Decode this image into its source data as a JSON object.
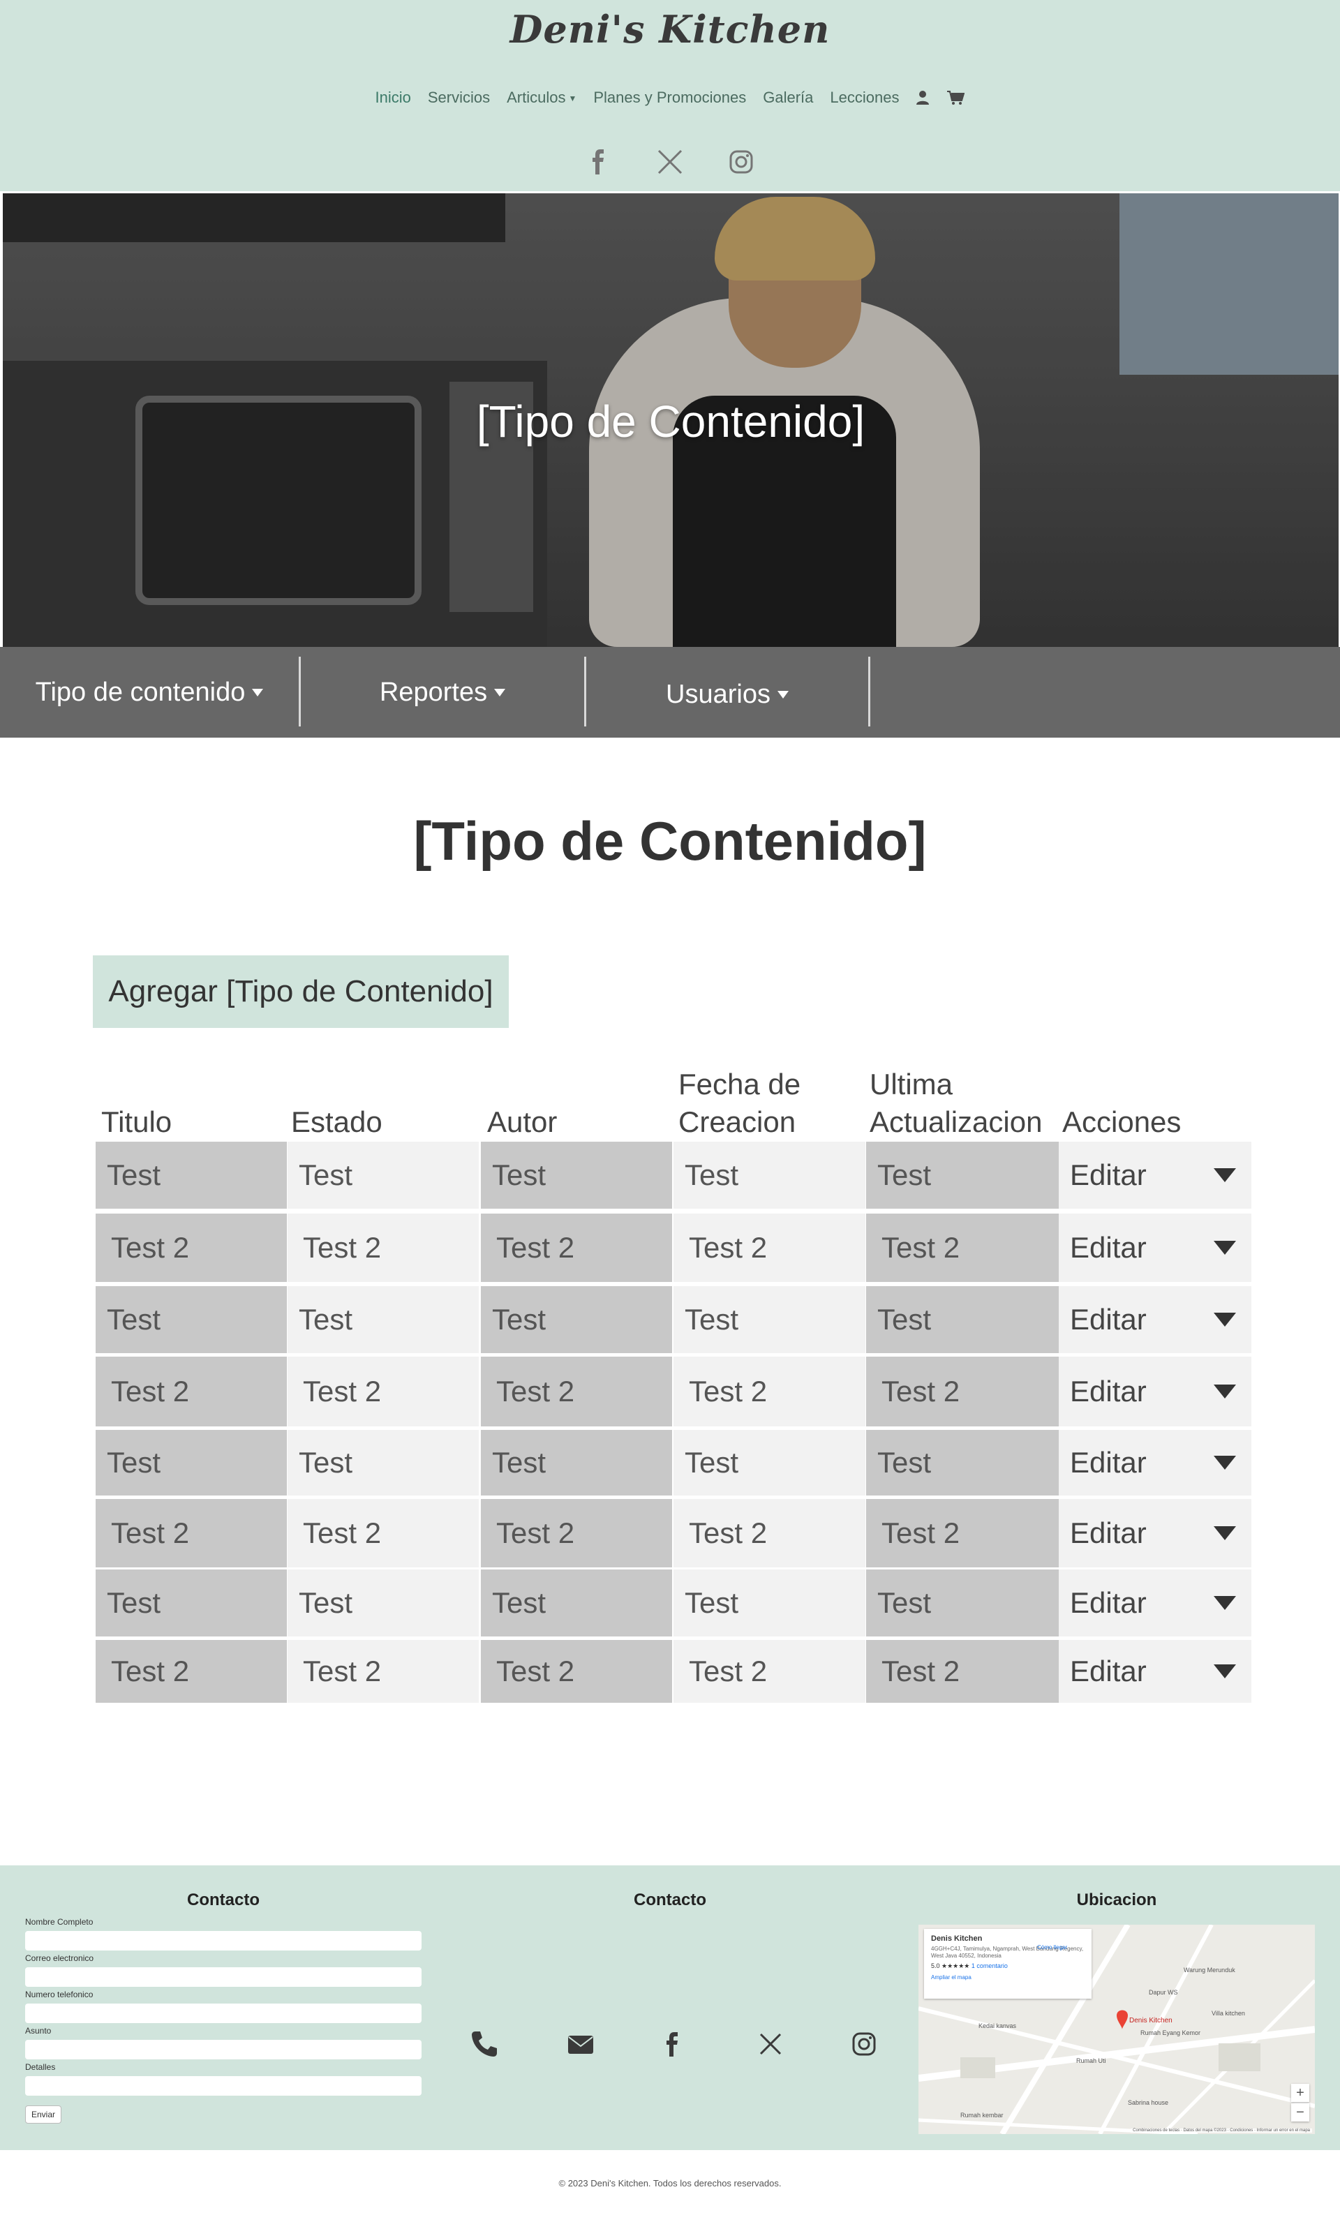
{
  "brand": {
    "name": "Deni's Kitchen"
  },
  "nav": {
    "items": [
      {
        "label": "Inicio"
      },
      {
        "label": "Servicios"
      },
      {
        "label": "Articulos"
      },
      {
        "label": "Planes y Promociones"
      },
      {
        "label": "Galería"
      },
      {
        "label": "Lecciones"
      }
    ],
    "icons": [
      "user-icon",
      "cart-icon"
    ]
  },
  "social_top": [
    "facebook-icon",
    "x-icon",
    "instagram-icon"
  ],
  "hero": {
    "title": "[Tipo de Contenido]"
  },
  "subnav": {
    "items": [
      {
        "label": "Tipo de contenido"
      },
      {
        "label": "Reportes"
      },
      {
        "label": "Usuarios"
      }
    ]
  },
  "main": {
    "title": "[Tipo de Contenido]",
    "add_button": "Agregar [Tipo de Contenido]"
  },
  "table": {
    "headers": [
      "Titulo",
      "Estado",
      "Autor",
      "Fecha de Creacion",
      "Ultima Actualizacion",
      "Acciones"
    ],
    "rows": [
      {
        "cells": [
          "Test",
          "Test",
          "Test",
          "Test",
          "Test"
        ],
        "action": "Editar"
      },
      {
        "cells": [
          "Test 2",
          "Test 2",
          "Test 2",
          "Test 2",
          "Test 2"
        ],
        "action": "Editar"
      },
      {
        "cells": [
          "Test",
          "Test",
          "Test",
          "Test",
          "Test"
        ],
        "action": "Editar"
      },
      {
        "cells": [
          "Test 2",
          "Test 2",
          "Test 2",
          "Test 2",
          "Test 2"
        ],
        "action": "Editar"
      },
      {
        "cells": [
          "Test",
          "Test",
          "Test",
          "Test",
          "Test"
        ],
        "action": "Editar"
      },
      {
        "cells": [
          "Test 2",
          "Test 2",
          "Test 2",
          "Test 2",
          "Test 2"
        ],
        "action": "Editar"
      },
      {
        "cells": [
          "Test",
          "Test",
          "Test",
          "Test",
          "Test"
        ],
        "action": "Editar"
      },
      {
        "cells": [
          "Test 2",
          "Test 2",
          "Test 2",
          "Test 2",
          "Test 2"
        ],
        "action": "Editar"
      }
    ]
  },
  "footer": {
    "contact_form": {
      "heading": "Contacto",
      "fields": [
        {
          "label": "Nombre Completo"
        },
        {
          "label": "Correo electronico"
        },
        {
          "label": "Numero telefonico"
        },
        {
          "label": "Asunto"
        },
        {
          "label": "Detalles"
        }
      ],
      "submit": "Enviar"
    },
    "contact_links": {
      "heading": "Contacto",
      "icons": [
        "phone-icon",
        "email-icon",
        "facebook-icon",
        "x-icon",
        "instagram-icon"
      ]
    },
    "location": {
      "heading": "Ubicacion",
      "map_card": {
        "title": "Denis Kitchen",
        "address": "4GGH+C4J, Tamimulya, Ngamprah, West Bandung Regency, West Java 40552, Indonesia",
        "rating": "5.0 ★★★★★",
        "reviews": "1 comentario",
        "link": "Ampliar el mapa",
        "directions": "Cómo llegar"
      },
      "map_labels": [
        "Denis Kitchen",
        "Rumah Eyang Kemor",
        "Warung Merunduk",
        "Dapur WS",
        "Kedai kanvas",
        "Rumah Uti",
        "Villa kitchen",
        "Sabrina house",
        "Rumah kembar"
      ],
      "map_footer": "Combinaciones de teclas · Datos del mapa ©2023 · Condiciones · Informar un error en el mapa"
    },
    "colors": {
      "accent": "#d0e4dc",
      "bar": "#676767"
    }
  },
  "copyright": "© 2023 Deni's Kitchen. Todos los derechos reservados."
}
